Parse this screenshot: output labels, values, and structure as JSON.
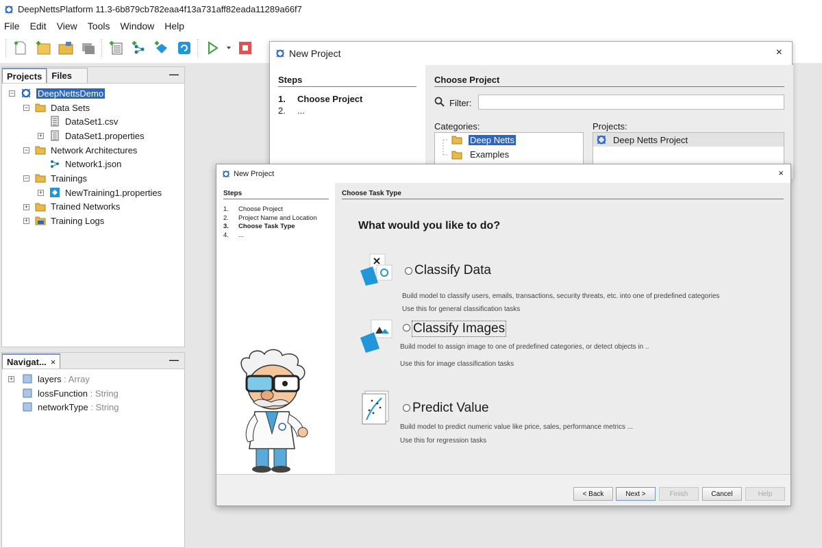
{
  "window": {
    "title": "DeepNettsPlatform 11.3-6b879cb782eaa4f13a731aff82eada11289a66f7"
  },
  "menu": [
    "File",
    "Edit",
    "View",
    "Tools",
    "Window",
    "Help"
  ],
  "toolbar_icons": [
    "new-file-icon",
    "new-project-icon",
    "open-project-icon",
    "close-project-icon",
    "dataset-icon",
    "network-icon",
    "training-icon",
    "refresh-icon",
    "run-icon",
    "run-dropdown-icon",
    "stop-icon"
  ],
  "projects_panel": {
    "tabs": [
      "Projects",
      "Files"
    ],
    "minimize": "—",
    "tree": [
      {
        "label": "DeepNettsDemo",
        "level": 0,
        "expander": "−",
        "icon": "deepnetts-project-icon",
        "selected": true
      },
      {
        "label": "Data Sets",
        "level": 1,
        "expander": "−",
        "icon": "folder-icon"
      },
      {
        "label": "DataSet1.csv",
        "level": 2,
        "expander": "",
        "icon": "csv-file-icon"
      },
      {
        "label": "DataSet1.properties",
        "level": 2,
        "expander": "+",
        "icon": "properties-file-icon"
      },
      {
        "label": "Network Architectures",
        "level": 1,
        "expander": "−",
        "icon": "folder-icon"
      },
      {
        "label": "Network1.json",
        "level": 2,
        "expander": "",
        "icon": "network-file-icon"
      },
      {
        "label": "Trainings",
        "level": 1,
        "expander": "−",
        "icon": "folder-icon"
      },
      {
        "label": "NewTraining1.properties",
        "level": 2,
        "expander": "+",
        "icon": "training-file-icon"
      },
      {
        "label": "Trained Networks",
        "level": 1,
        "expander": "+",
        "icon": "folder-icon"
      },
      {
        "label": "Training Logs",
        "level": 1,
        "expander": "+",
        "icon": "log-folder-icon"
      }
    ]
  },
  "navigator_panel": {
    "tab": "Navigat...",
    "close": "×",
    "minimize": "—",
    "items": [
      {
        "name": "layers",
        "type": " : Array",
        "expander": "+"
      },
      {
        "name": "lossFunction",
        "type": " : String",
        "expander": ""
      },
      {
        "name": "networkType",
        "type": " : String",
        "expander": ""
      }
    ]
  },
  "dialog_back": {
    "title": "New Project",
    "close": "×",
    "steps_heading": "Steps",
    "steps": [
      {
        "num": "1.",
        "label": "Choose Project"
      },
      {
        "num": "2.",
        "label": "..."
      }
    ],
    "content_heading": "Choose Project",
    "filter_label": "Filter:",
    "filter_value": "",
    "categories_label": "Categories:",
    "categories": [
      "Deep Netts",
      "Examples"
    ],
    "projects_label": "Projects:",
    "projects": [
      "Deep Netts Project"
    ]
  },
  "dialog_front": {
    "title": "New Project",
    "close": "×",
    "steps_heading": "Steps",
    "steps": [
      {
        "num": "1.",
        "label": "Choose Project"
      },
      {
        "num": "2.",
        "label": "Project Name and Location"
      },
      {
        "num": "3.",
        "label": "Choose Task Type"
      },
      {
        "num": "4.",
        "label": "..."
      }
    ],
    "content_heading": "Choose Task Type",
    "question": "What would you like to do?",
    "options": [
      {
        "label": "Classify Data",
        "desc1": "Build model to classify users, emails, transactions, security threats, etc. into one of predefined categories",
        "desc2": "Use this for general classification tasks",
        "icon": "classify-data-icon"
      },
      {
        "label": "Classify Images",
        "desc1": "Build model to assign image to one of predefined categories, or detect objects in ..",
        "desc2": "Use this for image classification tasks",
        "icon": "classify-images-icon"
      },
      {
        "label": "Predict Value",
        "desc1": "Build model to predict numeric value like price, sales, performance metrics ...",
        "desc2": "Use this for regression tasks",
        "icon": "predict-value-icon"
      }
    ],
    "buttons": {
      "back": "< Back",
      "next": "Next >",
      "finish": "Finish",
      "cancel": "Cancel",
      "help": "Help"
    }
  },
  "colors": {
    "selection": "#2a67c5",
    "accent_blue": "#2196d8",
    "folder": "#e9b94a",
    "run_green": "#3aa33a",
    "stop_red": "#e25050"
  }
}
